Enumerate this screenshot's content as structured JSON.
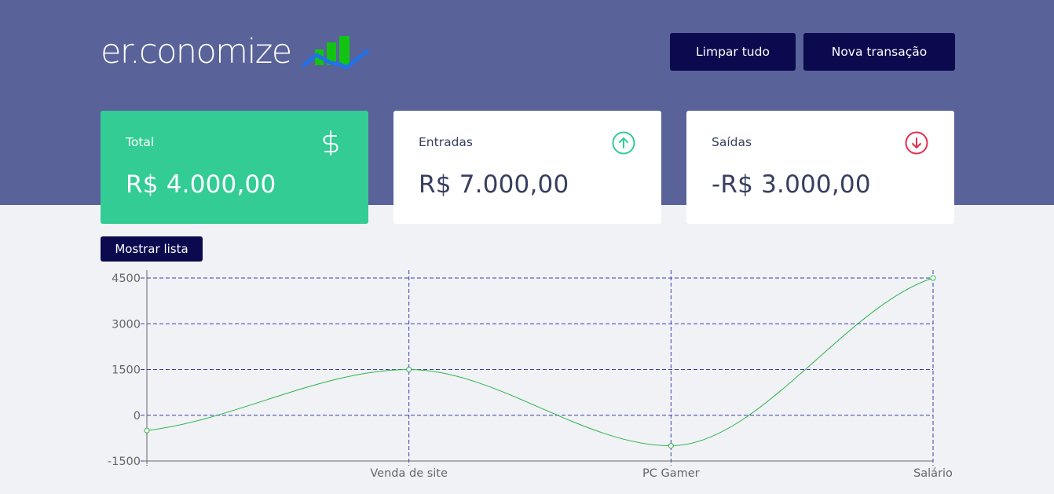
{
  "app": {
    "logo_text": "er.conomize",
    "logo_icon": "bar-chart-trend-icon"
  },
  "header": {
    "clear_button": "Limpar tudo",
    "new_button": "Nova transação"
  },
  "summary": {
    "total": {
      "label": "Total",
      "value": "R$ 4.000,00",
      "icon": "dollar-sign-icon",
      "color": "#33cc95"
    },
    "income": {
      "label": "Entradas",
      "value": "R$ 7.000,00",
      "icon": "arrow-up-circle-icon",
      "color": "#33cc95"
    },
    "expense": {
      "label": "Saídas",
      "value": "-R$ 3.000,00",
      "icon": "arrow-down-circle-icon",
      "color": "#e52e4d"
    }
  },
  "list_toggle": {
    "label": "Mostrar lista"
  },
  "colors": {
    "header": "#5a629a",
    "button": "#0b0a4f",
    "background": "#f0f2f5",
    "grid": "#3b3bb3",
    "line": "#2db34a"
  },
  "chart_data": {
    "type": "line",
    "categories": [
      "",
      "Venda de site",
      "PC Gamer",
      "Salário"
    ],
    "series": [
      {
        "values": [
          -500,
          1500,
          -1000,
          4500
        ]
      }
    ],
    "y_ticks": [
      -1500,
      0,
      1500,
      3000,
      4500
    ],
    "ylim": [
      -1500,
      4500
    ],
    "smooth": true,
    "grid": true
  }
}
